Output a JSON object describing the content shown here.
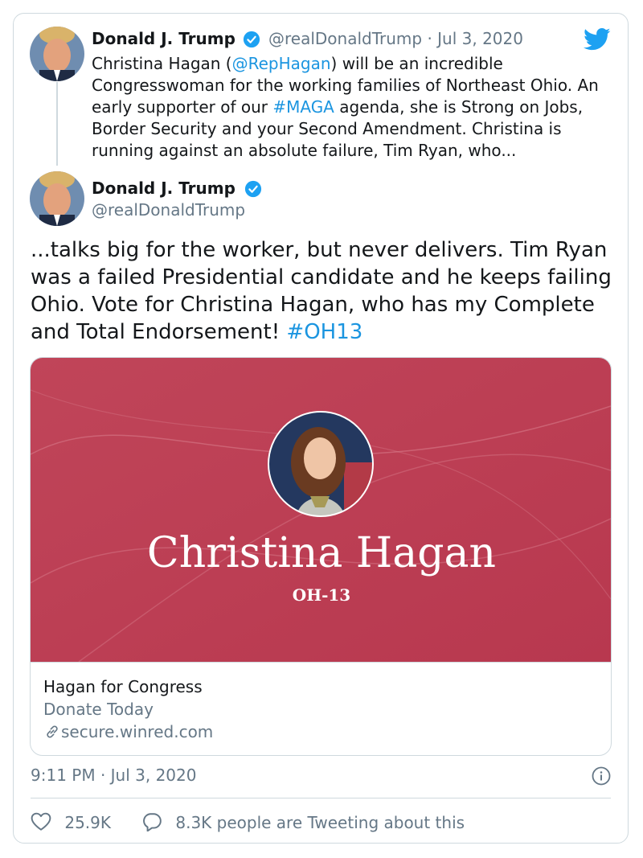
{
  "quoted_tweet": {
    "author_name": "Donald J. Trump",
    "handle": "@realDonaldTrump",
    "separator": "·",
    "date": "Jul 3, 2020",
    "text_parts": {
      "p1": "Christina Hagan (",
      "mention": "@RepHagan",
      "p2": ") will be an incredible Congresswoman for the working families of Northeast Ohio. An early supporter of our ",
      "hashtag": "#MAGA",
      "p3": " agenda, she is Strong on Jobs, Border Security and your Second Amendment. Christina is running against an absolute failure, Tim Ryan, who..."
    }
  },
  "main_tweet": {
    "author_name": "Donald J. Trump",
    "handle": "@realDonaldTrump",
    "text_main": "...talks big for the worker, but never delivers. Tim Ryan was a failed Presidential candidate and he keeps failing Ohio. Vote for Christina Hagan, who has my Complete and Total Endorsement! ",
    "hashtag": "#OH13",
    "timestamp": "9:11 PM · Jul 3, 2020"
  },
  "link_card": {
    "image_name": "Christina Hagan",
    "image_district": "OH-13",
    "title": "Hagan for Congress",
    "description": "Donate Today",
    "domain": "secure.winred.com"
  },
  "stats": {
    "likes": "25.9K",
    "tweeting": "8.3K people are Tweeting about this"
  },
  "colors": {
    "link": "#1b95e0",
    "muted": "#657786",
    "card_bg": "#c2485d",
    "border": "#cfd9de"
  },
  "icons": [
    "verified-icon",
    "twitter-bird-icon",
    "link-icon",
    "info-icon",
    "heart-icon",
    "reply-bubble-icon"
  ]
}
